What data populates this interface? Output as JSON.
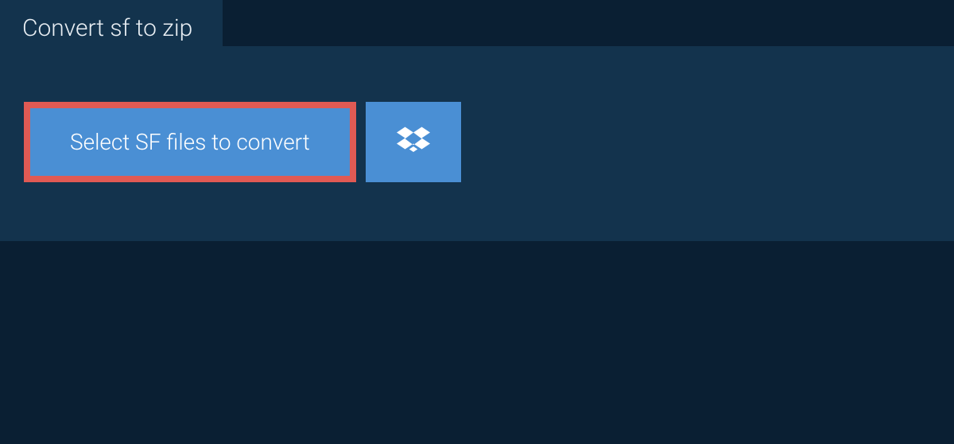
{
  "tab": {
    "title": "Convert sf to zip"
  },
  "actions": {
    "select_files_label": "Select SF files to convert"
  },
  "colors": {
    "background": "#0a1f33",
    "panel": "#13334d",
    "button": "#4a8fd4",
    "highlight_border": "#e05a54",
    "text_light": "#e8eef3",
    "text_white": "#ffffff"
  }
}
